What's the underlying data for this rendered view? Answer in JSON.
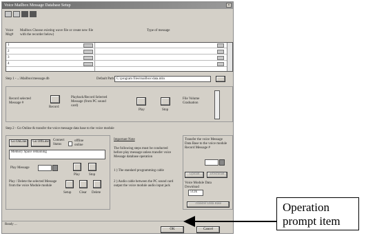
{
  "window": {
    "title": "Voice Mailbox Message Database Setup"
  },
  "grid_header": {
    "col1": "Voice Msg#",
    "col2": "Mailbox Choose existing wave file or create new file with the recorder below)",
    "col3": "Type of message"
  },
  "grid": {
    "rows": [
      "1",
      "2",
      "3",
      "4"
    ]
  },
  "path": {
    "label": "Step 1 - ...\\Mailbox\\message.db",
    "default_label": "Default Path",
    "value": "C:\\program files\\mailbox\\data.mbx"
  },
  "record": {
    "record_label": "Record selected Message #",
    "rerecord_label": "Record",
    "play_label": "Playback/Record Selected Message (from PC sound card)",
    "play": "Play",
    "stop": "Stop",
    "file_volume": "File Volume Graduation"
  },
  "step2": {
    "text": "Step 2 - Go Online & transfer the voice message data base to the voice module"
  },
  "online": {
    "go_online": "Go OnLine",
    "go_offline": "Go OffLine",
    "connect": "Connect Status",
    "offline": "offline online",
    "memory": "Memory Space remaining",
    "play_message": "Play Message",
    "play_btn": "Play",
    "stop_btn": "Stop",
    "delete_text": "Play / Delete the selected Message from the voice Module module",
    "setup": "Setup",
    "clear": "Clear",
    "delete": "Delete"
  },
  "notes": {
    "heading": "Important Note",
    "line1": "The following steps must be conducted before play message unless transfer voice Message database operation",
    "line2": "1 ) The standard programming cable",
    "line3": "2 ) Audio cable between the PC sound card output the voice module audio input jack"
  },
  "transfer": {
    "text": "Transfer the voice Message Data Base to the voice module Record Message #",
    "upload": "Upload",
    "download": "Download",
    "size_label": "Voice Module Data Download",
    "size_value": "512k",
    "button": "Transfer Data Base"
  },
  "status": {
    "text": "Ready ..."
  },
  "dialog": {
    "ok": "OK",
    "cancel": "Cancel"
  },
  "callout": {
    "line1": "Operation",
    "line2": "prompt item"
  }
}
